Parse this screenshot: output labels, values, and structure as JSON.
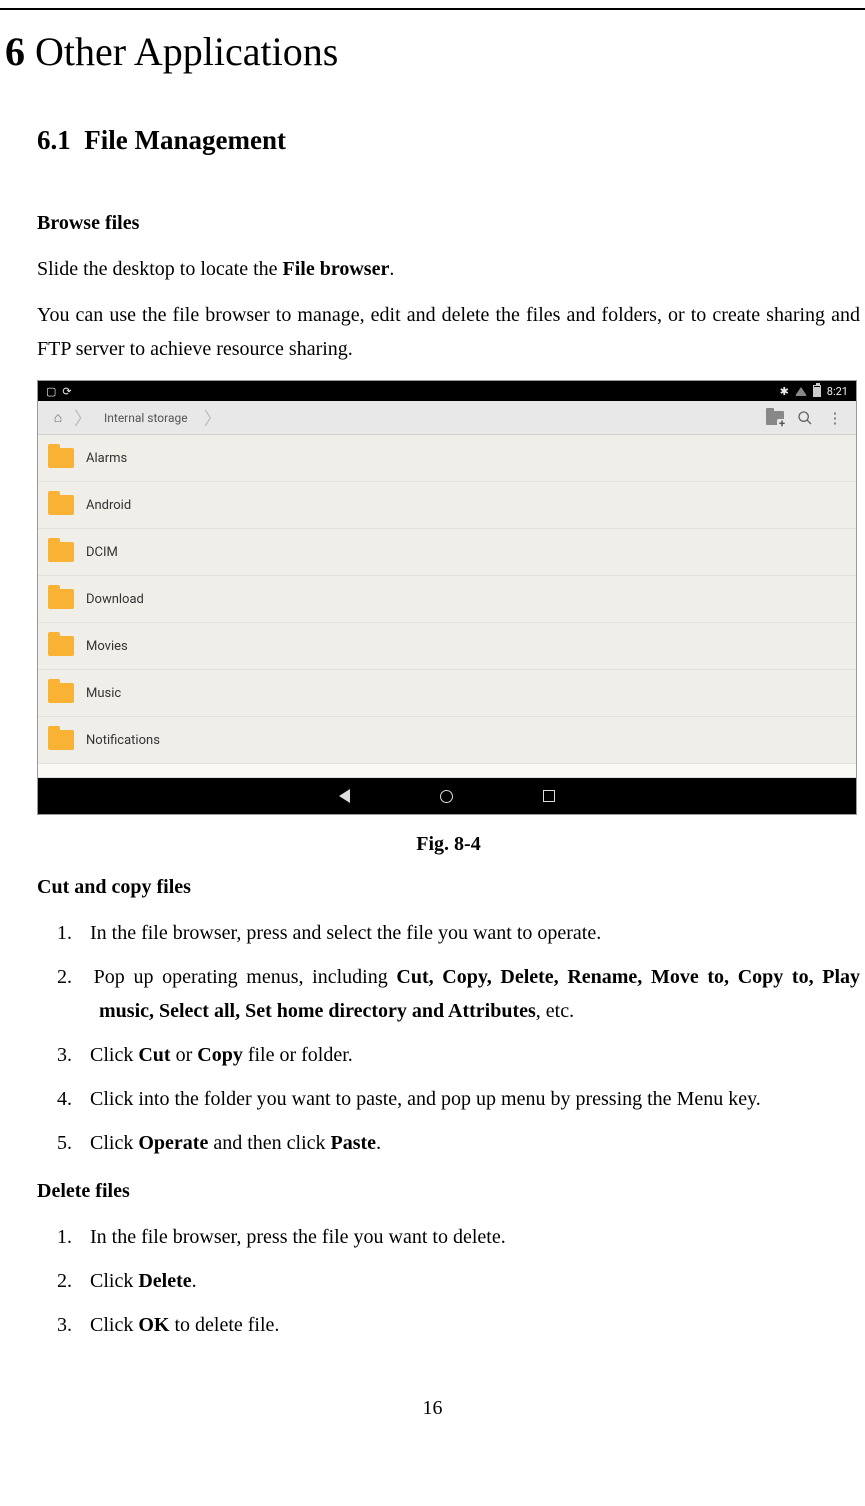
{
  "chapter": {
    "number": "6",
    "title": "Other Applications"
  },
  "section": {
    "number": "6.1",
    "title": "File Management"
  },
  "browse": {
    "heading": "Browse files",
    "p1_pre": "Slide the desktop to locate the ",
    "p1_bold": "File browser",
    "p1_post": ".",
    "p2": "You can use the file browser to manage, edit and delete the files and folders, or to create sharing and FTP server to achieve resource sharing."
  },
  "screenshot": {
    "status_time": "8:21",
    "breadcrumb": "Internal storage",
    "folders": [
      "Alarms",
      "Android",
      "DCIM",
      "Download",
      "Movies",
      "Music",
      "Notifications"
    ]
  },
  "figure_caption": "Fig. 8-4",
  "cutcopy": {
    "heading": "Cut and copy files",
    "items": [
      {
        "n": "1.",
        "pre": "In the file browser, press and select the file you want to operate."
      },
      {
        "n": "2.",
        "pre": "Pop up operating menus, including ",
        "bold": "Cut, Copy, Delete, Rename, Move to, Copy to, Play music, Select all, Set home directory and Attributes",
        "post": ", etc."
      },
      {
        "n": "3.",
        "pre": "Click ",
        "bold": "Cut",
        "mid": " or ",
        "bold2": "Copy",
        "post": " file or folder."
      },
      {
        "n": "4.",
        "pre": "Click into the folder you want to paste, and pop up menu by pressing the Menu key."
      },
      {
        "n": "5.",
        "pre": "Click ",
        "bold": "Operate",
        "mid": " and then click ",
        "bold2": "Paste",
        "post": "."
      }
    ]
  },
  "delete": {
    "heading": "Delete files",
    "items": [
      {
        "n": "1.",
        "pre": "In the file browser, press the file you want to delete."
      },
      {
        "n": "2.",
        "pre": "Click ",
        "bold": "Delete",
        "post": "."
      },
      {
        "n": "3.",
        "pre": "Click ",
        "bold": "OK",
        "post": " to delete file."
      }
    ]
  },
  "page_number": "16"
}
